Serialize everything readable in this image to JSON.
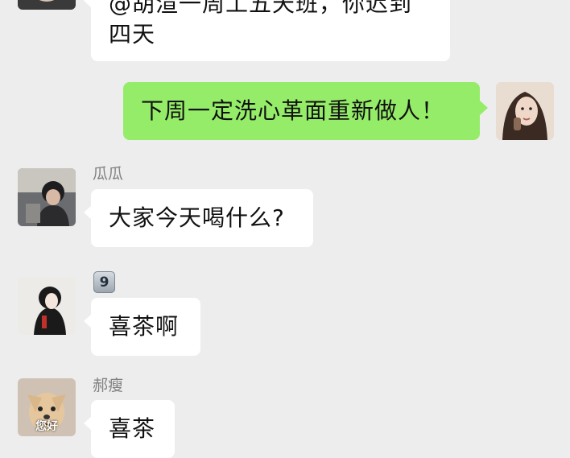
{
  "messages": [
    {
      "id": "m1",
      "direction": "in",
      "sender": "",
      "text": "@胡渲一周工五天班，你迟到四天"
    },
    {
      "id": "m2",
      "direction": "out",
      "sender": "",
      "text": "下周一定洗心革面重新做人！"
    },
    {
      "id": "m3",
      "direction": "in",
      "sender": "瓜瓜",
      "text": "大家今天喝什么?"
    },
    {
      "id": "m4",
      "direction": "in",
      "sender": "9",
      "text": "喜茶啊"
    },
    {
      "id": "m5",
      "direction": "in",
      "sender": "郝瘦",
      "text": "喜茶",
      "avatar_caption": "您好"
    }
  ],
  "colors": {
    "background": "#ededed",
    "incoming_bubble": "#ffffff",
    "outgoing_bubble": "#95ec69",
    "nickname": "#808080"
  }
}
